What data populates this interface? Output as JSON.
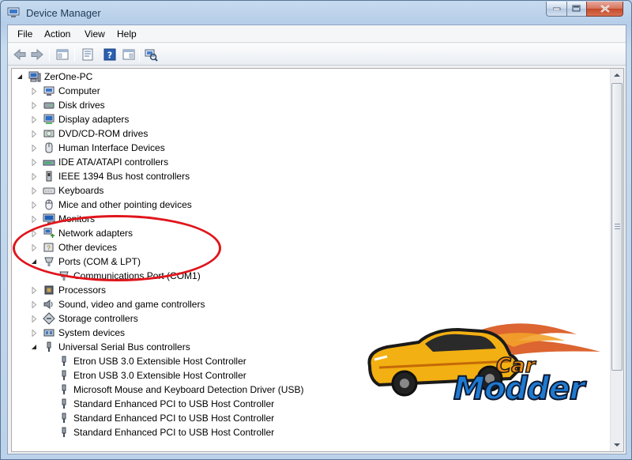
{
  "window": {
    "title": "Device Manager"
  },
  "menu": [
    "File",
    "Action",
    "View",
    "Help"
  ],
  "toolbar": {
    "buttons": [
      "back-arrow-icon",
      "forward-arrow-icon",
      "console-tree-icon",
      "properties-icon",
      "help-icon",
      "scan-hardware-icon"
    ]
  },
  "tree": {
    "root": "ZerOne-PC",
    "categories": [
      {
        "label": "Computer",
        "icon": "computer-icon",
        "expanded": false
      },
      {
        "label": "Disk drives",
        "icon": "disk-drive-icon",
        "expanded": false
      },
      {
        "label": "Display adapters",
        "icon": "display-adapter-icon",
        "expanded": false
      },
      {
        "label": "DVD/CD-ROM drives",
        "icon": "dvd-drive-icon",
        "expanded": false
      },
      {
        "label": "Human Interface Devices",
        "icon": "hid-icon",
        "expanded": false
      },
      {
        "label": "IDE ATA/ATAPI controllers",
        "icon": "ide-controller-icon",
        "expanded": false
      },
      {
        "label": "IEEE 1394 Bus host controllers",
        "icon": "firewire-icon",
        "expanded": false
      },
      {
        "label": "Keyboards",
        "icon": "keyboard-icon",
        "expanded": false
      },
      {
        "label": "Mice and other pointing devices",
        "icon": "mouse-icon",
        "expanded": false
      },
      {
        "label": "Monitors",
        "icon": "monitor-icon",
        "expanded": false
      },
      {
        "label": "Network adapters",
        "icon": "network-adapter-icon",
        "expanded": false
      },
      {
        "label": "Other devices",
        "icon": "other-devices-icon",
        "expanded": false
      },
      {
        "label": "Ports (COM & LPT)",
        "icon": "port-icon",
        "expanded": true,
        "children": [
          "Communications Port (COM1)"
        ]
      },
      {
        "label": "Processors",
        "icon": "processor-icon",
        "expanded": false
      },
      {
        "label": "Sound, video and game controllers",
        "icon": "sound-icon",
        "expanded": false
      },
      {
        "label": "Storage controllers",
        "icon": "storage-controller-icon",
        "expanded": false
      },
      {
        "label": "System devices",
        "icon": "system-device-icon",
        "expanded": false
      },
      {
        "label": "Universal Serial Bus controllers",
        "icon": "usb-icon",
        "expanded": true,
        "children": [
          "Etron USB 3.0 Extensible Host Controller",
          "Etron USB 3.0 Extensible Host Controller",
          "Microsoft Mouse and Keyboard Detection Driver (USB)",
          "Standard Enhanced PCI to USB Host Controller",
          "Standard Enhanced PCI to USB Host Controller",
          "Standard Enhanced PCI to USB Host Controller"
        ]
      }
    ]
  },
  "watermark": {
    "line1": "Car",
    "line2": "Modder"
  },
  "colors": {
    "highlight": "#e0151b",
    "logo_blue": "#1f7ad1",
    "logo_orange": "#f08a10"
  }
}
